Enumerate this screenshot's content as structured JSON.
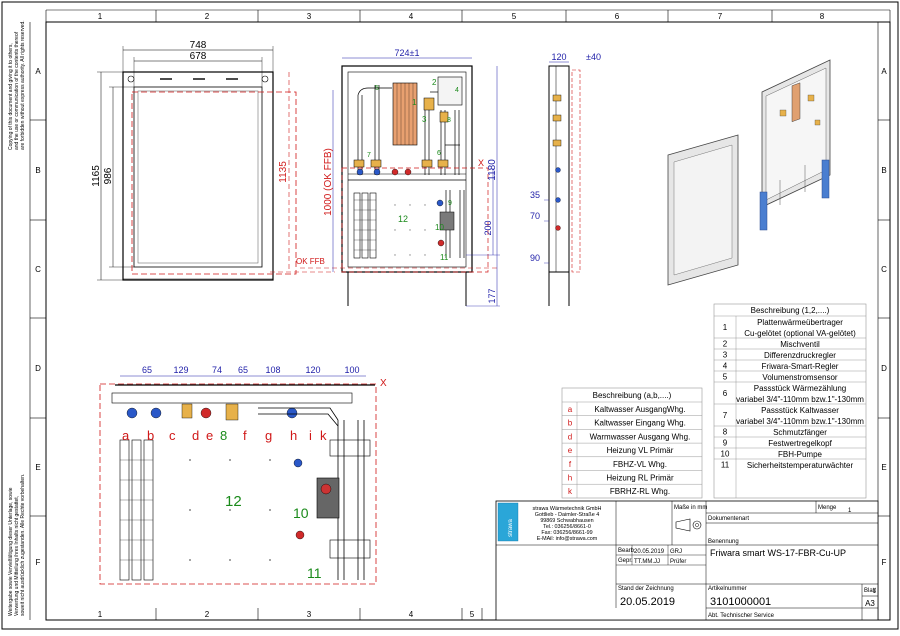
{
  "grid": {
    "columns": [
      "1",
      "2",
      "3",
      "4",
      "5",
      "6",
      "7",
      "8"
    ],
    "rows": [
      "A",
      "B",
      "C",
      "D",
      "E",
      "F"
    ]
  },
  "notes": {
    "copyright": [
      "Copying of this document and giving it to others,",
      "and the use or communication of the contents thereof",
      "are forbidden without express authority. All rights reserved."
    ],
    "weitergabe": [
      "Weitergabe sowie Vervielfältigung dieser Unterlage, sowie",
      "Verwertung und Mitteilung ihres Inhalts nicht gestattet,",
      "soweit nicht ausdrücklich zugestanden. Alle Rechte vorbehalten."
    ]
  },
  "front_view": {
    "width_outer": "748",
    "width_inner": "678",
    "height_outer": "1165",
    "height_inner": "986"
  },
  "side_dims": {
    "total": "1135"
  },
  "center_view": {
    "width": "724±1",
    "ref": "OK FFB",
    "height_ref": "1000 (OK FFB)",
    "height_total": "1180",
    "h_200": "200",
    "h_177": "177",
    "x_mark": "X"
  },
  "side_view": {
    "d120": "120",
    "d40": "±40",
    "d35": "35",
    "d70": "70",
    "d90": "90"
  },
  "detail_view": {
    "dims": [
      "65",
      "129",
      "74",
      "65",
      "108",
      "120",
      "100"
    ],
    "letters": [
      "a",
      "b",
      "c",
      "d",
      "e",
      "f",
      "g",
      "h",
      "i",
      "k"
    ],
    "num8": "8",
    "num10": "10",
    "num11": "11",
    "num12": "12",
    "x_mark": "X"
  },
  "center_labels": {
    "n1": "1",
    "n2": "2",
    "n3": "3",
    "n4": "4",
    "n5": "5",
    "n6": "6",
    "n7": "7",
    "n8": "8",
    "n9": "9",
    "n10": "10",
    "n11": "11",
    "n12": "12"
  },
  "legend_num": {
    "title": "Beschreibung (1,2,....)",
    "rows": [
      {
        "n": "1",
        "lines": [
          "Plattenwärmeübertrager",
          "Cu-gelötet (optional VA-gelötet)"
        ]
      },
      {
        "n": "2",
        "lines": [
          "Mischventil"
        ]
      },
      {
        "n": "3",
        "lines": [
          "Differenzdruckregler"
        ]
      },
      {
        "n": "4",
        "lines": [
          "Friwara-Smart-Regler"
        ]
      },
      {
        "n": "5",
        "lines": [
          "Volumenstromsensor"
        ]
      },
      {
        "n": "6",
        "lines": [
          "Passstück Wärmezählung",
          "variabel 3/4\"-110mm bzw.1\"-130mm"
        ]
      },
      {
        "n": "7",
        "lines": [
          "Passstück Kaltwasser",
          "variabel 3/4\"-110mm bzw.1\"-130mm"
        ]
      },
      {
        "n": "8",
        "lines": [
          "Schmutzfänger"
        ]
      },
      {
        "n": "9",
        "lines": [
          "Festwertregelkopf"
        ]
      },
      {
        "n": "10",
        "lines": [
          "FBH-Pumpe"
        ]
      },
      {
        "n": "11",
        "lines": [
          "Sicherheitstemperaturwächter"
        ]
      }
    ]
  },
  "legend_alpha": {
    "title": "Beschreibung (a,b,....)",
    "rows": [
      {
        "n": "a",
        "text": "Kaltwasser AusgangWhg."
      },
      {
        "n": "b",
        "text": "Kaltwasser Eingang Whg."
      },
      {
        "n": "d",
        "text": "Warmwasser Ausgang Whg."
      },
      {
        "n": "e",
        "text": "Heizung VL Primär"
      },
      {
        "n": "f",
        "text": "FBHZ-VL Whg."
      },
      {
        "n": "h",
        "text": "Heizung RL Primär"
      },
      {
        "n": "k",
        "text": "FBRHZ-RL Whg."
      }
    ]
  },
  "title_block": {
    "company": [
      "strawa Wärmetechnik GmbH",
      "Gottlieb - Daimler-Straße 4",
      "99869 Schwabhausen",
      "Tel.: 036256/8661-0",
      "Fax: 036256/8661-99",
      "E-MAil: info@strawa.com"
    ],
    "logo": "strawa",
    "massstab_label": "Maße in mm",
    "menge_label": "Menge",
    "menge_value": "1",
    "dokumentenart": "Dokumentenart",
    "benennung_label": "Benennung",
    "benennung": "Friwara smart WS-17-FBR-Cu-UP",
    "bearb_label": "Bearb.",
    "bearb_date": "20.05.2019",
    "bearb_name": "GRJ",
    "gepr_label": "Gepr.",
    "gepr_date": "TT.MM.JJ",
    "gepr_name": "Prüfer",
    "stand_label": "Stand der Zeichnung",
    "stand": "20.05.2019",
    "artikel_label": "Artikelnummer",
    "artikel": "3101000001",
    "blatt_label": "Blatt",
    "blatt": "1",
    "format": "A3",
    "abt": "Abt. Technischer Service"
  }
}
